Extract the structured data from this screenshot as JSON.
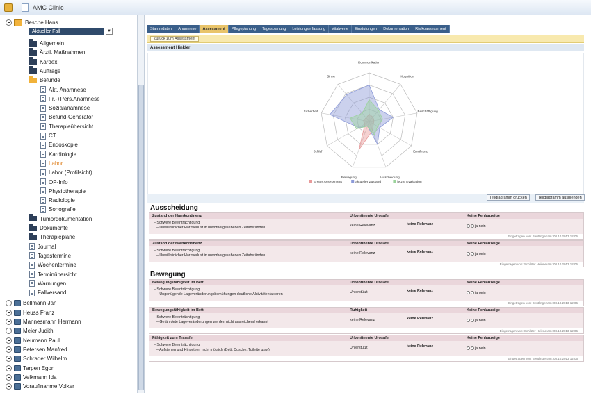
{
  "window": {
    "title": "AMC Clinic"
  },
  "tree": {
    "patients_top": [
      {
        "name": "Besche Hans"
      }
    ],
    "current_view": "Aktueller Fall",
    "sections": [
      {
        "label": "Allgemein",
        "type": "sec"
      },
      {
        "label": "Ärztl. Maßnahmen",
        "type": "sec"
      },
      {
        "label": "Kardex",
        "type": "sec"
      },
      {
        "label": "Aufträge",
        "type": "sec"
      },
      {
        "label": "Befunde",
        "type": "sec-open"
      },
      {
        "label": "Akt. Anamnese",
        "type": "doc"
      },
      {
        "label": "Fr.-+Pers.Anamnese",
        "type": "doc"
      },
      {
        "label": "Sozialanamnese",
        "type": "doc"
      },
      {
        "label": "Befund-Generator",
        "type": "doc"
      },
      {
        "label": "Therapieübersicht",
        "type": "doc"
      },
      {
        "label": "CT",
        "type": "doc"
      },
      {
        "label": "Endoskopie",
        "type": "doc"
      },
      {
        "label": "Kardiologie",
        "type": "doc"
      },
      {
        "label": "Labor",
        "type": "doc",
        "orange": true
      },
      {
        "label": "Labor (Profilsicht)",
        "type": "doc"
      },
      {
        "label": "OP-Info",
        "type": "doc"
      },
      {
        "label": "Physiotherapie",
        "type": "doc"
      },
      {
        "label": "Radiologie",
        "type": "doc"
      },
      {
        "label": "Sonografie",
        "type": "doc"
      },
      {
        "label": "Tumordokumentation",
        "type": "sec"
      },
      {
        "label": "Dokumente",
        "type": "sec"
      },
      {
        "label": "Therapiepläne",
        "type": "sec"
      },
      {
        "label": "Journal",
        "type": "doc"
      },
      {
        "label": "Tagestermine",
        "type": "doc"
      },
      {
        "label": "Wochentermine",
        "type": "doc"
      },
      {
        "label": "Terminübersicht",
        "type": "doc"
      },
      {
        "label": "Warnungen",
        "type": "doc"
      },
      {
        "label": "Fallversand",
        "type": "doc"
      }
    ],
    "patients": [
      "Bellmann Jan",
      "Heuss Franz",
      "Mannesmann Hermann",
      "Meier Judith",
      "Neumann Paul",
      "Petersen Manfred",
      "Schrader Wilhelm",
      "Tarpen Egon",
      "Velkmann Ida",
      "Vorauflnahme Volker"
    ]
  },
  "tabs": [
    {
      "label": "Stammdaten"
    },
    {
      "label": "Anamnese"
    },
    {
      "label": "Assessment",
      "active": true
    },
    {
      "label": "Pflegeplanung"
    },
    {
      "label": "Tagesplanung"
    },
    {
      "label": "Leistungserfassung"
    },
    {
      "label": "Vitalwerte"
    },
    {
      "label": "Einstufungen"
    },
    {
      "label": "Dokumentation"
    },
    {
      "label": "Risikoassessment"
    }
  ],
  "subbar": {
    "button": "Zurück zum Assessment"
  },
  "section_header": "Assessment Hinkler",
  "chart_data": {
    "type": "radar",
    "axes": [
      "Kommunikation",
      "Kognition",
      "Beschäftigung",
      "Ernährung",
      "Ausscheidung",
      "Bewegung",
      "Schlaf",
      "Sicherheit",
      "Sinne"
    ],
    "series": [
      {
        "name": "Erstes Assessment",
        "color": "#e89a9a",
        "values": [
          0.15,
          0.12,
          0.1,
          0.1,
          0.2,
          0.62,
          0.1,
          0.12,
          0.1
        ]
      },
      {
        "name": "aktueller Zustand",
        "color": "#8c9ad8",
        "values": [
          0.75,
          0.32,
          0.5,
          0.25,
          0.5,
          0.1,
          0.25,
          0.82,
          0.72
        ]
      },
      {
        "name": "letzte Evaluation",
        "color": "#9bd39b",
        "values": [
          0.45,
          0.3,
          0.28,
          0.2,
          0.3,
          0.1,
          0.3,
          0.4,
          0.22
        ]
      }
    ]
  },
  "chart_buttons": {
    "left": "Teildiagramm drucken",
    "right": "Teildiagramm ausblenden"
  },
  "groups": [
    {
      "title": "Ausscheidung",
      "cards": [
        {
          "head1": "Zustand der Harnkontinenz",
          "head2": "Urkontinente Urosafe",
          "head3": "Keine Fehlanzeige",
          "line1": "– Schwere Beeinträchtigung",
          "line2": "– Unwillkürlicher Harnverlust in unvorhergesehenen Zeitabständen",
          "val1": "keine Relevanz",
          "val2": "keine Relevanz",
          "radio": "ja    nein",
          "foot": "Eingetragen von: Beutlinger am: 08.10.2013 12:06"
        },
        {
          "head1": "Zustand der Harnkontinenz",
          "head2": "Urkontinente Urosafe",
          "head3": "Keine Fehlanzeige",
          "line1": "– Schwere Beeinträchtigung",
          "line2": "– Unwillkürlicher Harnverlust in unvorhergesehenen Zeitabständen",
          "val1": "keine Relevanz",
          "val2": "keine Relevanz",
          "radio": "ja    nein",
          "foot": "Eingetragen von: Schlüter Helene am: 08.10.2013 12:06"
        }
      ]
    },
    {
      "title": "Bewegung",
      "cards": [
        {
          "head1": "Bewegungsfähigkeit im Bett",
          "head2": "Urkontinente Urosafe",
          "head3": "Keine Fehlanzeige",
          "line1": "– Schwere Beeinträchtigung",
          "line2": "– Ungenügende Lageveränderungsbemühungen deutliche Aktivitätenfaktoren",
          "val1": "Unterstützt",
          "val2": "keine Relevanz",
          "radio": "ja    nein",
          "foot": "Eingetragen von: Beutlinger am: 08.10.2013 12:06"
        },
        {
          "head1": "Bewegungsfähigkeit im Bett",
          "head2": "Ruhigkeit",
          "head3": "Keine Fehlanzeige",
          "line1": "– Schwere Beeinträchtigung",
          "line2": "– Gefährdete Lageveränderungen werden nicht ausreichend erkannt",
          "val1": "keine Relevanz",
          "val2": "keine Relevanz",
          "radio": "ja    nein",
          "foot": "Eingetragen von: Schlüter Helene am: 08.10.2013 12:06"
        },
        {
          "head1": "Fähigkeit zum Transfer",
          "head2": "Urkontinente Urosafe",
          "head3": "Keine Fehlanzeige",
          "line1": "– Schwere Beeinträchtigung",
          "line2": "– Aufstehen und Hinsetzen nicht möglich (Bett, Dusche, Toilette usw.)",
          "val1": "Unterstützt",
          "val2": "keine Relevanz",
          "radio": "ja    nein",
          "foot": "Eingetragen von: Beutlinger am: 08.10.2013 12:06"
        }
      ]
    }
  ]
}
